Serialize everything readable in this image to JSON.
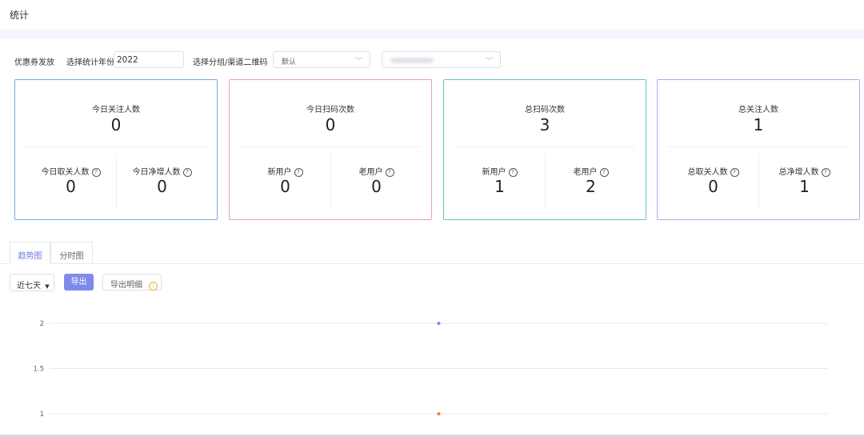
{
  "header": {
    "title": "统计"
  },
  "filters": {
    "coupon_label": "优惠券发放",
    "year_label": "选择统计年份",
    "year_value": "2022",
    "group_label": "选择分组/渠道二维码",
    "group_select_value": "默认"
  },
  "cards": [
    {
      "title": "今日关注人数",
      "value": "0",
      "subs": [
        {
          "label": "今日取关人数",
          "value": "0"
        },
        {
          "label": "今日净增人数",
          "value": "0"
        }
      ]
    },
    {
      "title": "今日扫码次数",
      "value": "0",
      "subs": [
        {
          "label": "新用户",
          "value": "0"
        },
        {
          "label": "老用户",
          "value": "0"
        }
      ]
    },
    {
      "title": "总扫码次数",
      "value": "3",
      "subs": [
        {
          "label": "新用户",
          "value": "1"
        },
        {
          "label": "老用户",
          "value": "2"
        }
      ]
    },
    {
      "title": "总关注人数",
      "value": "1",
      "subs": [
        {
          "label": "总取关人数",
          "value": "0"
        },
        {
          "label": "总净增人数",
          "value": "1"
        }
      ]
    }
  ],
  "tabs": [
    {
      "label": "趋势图"
    },
    {
      "label": "分时图"
    }
  ],
  "toolbar": {
    "range_label": "近七天",
    "export_label": "导出",
    "export_detail_label": "导出明细"
  },
  "colors": {
    "card_borders": [
      "#7aa7e6",
      "#f0a0a8",
      "#5cc6c9",
      "#a9b0e8"
    ],
    "primary": "#7e8bec",
    "active_tab": "#6b7ae0",
    "series_a": "#7b86e8",
    "series_b": "#f07a4a"
  },
  "chart_data": {
    "type": "scatter",
    "y_ticks": [
      "2",
      "1.5",
      "1"
    ],
    "ylim": [
      1,
      2
    ],
    "series": [
      {
        "values": [
          {
            "x": 4,
            "y": 2
          }
        ]
      },
      {
        "values": [
          {
            "x": 4,
            "y": 1
          }
        ]
      }
    ],
    "x_count": 7,
    "grid": true
  }
}
